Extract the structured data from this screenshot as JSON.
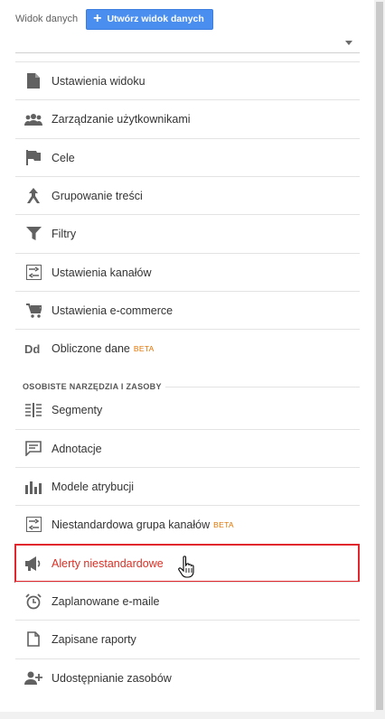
{
  "header": {
    "label": "Widok danych",
    "create_button": "Utwórz widok danych",
    "create_icon": "plus-icon"
  },
  "view_select": {
    "value": ""
  },
  "menu_main": [
    {
      "label": "Ustawienia widoku",
      "icon": "document-icon"
    },
    {
      "label": "Zarządzanie użytkownikami",
      "icon": "users-icon"
    },
    {
      "label": "Cele",
      "icon": "flag-icon"
    },
    {
      "label": "Grupowanie treści",
      "icon": "content-grouping-icon"
    },
    {
      "label": "Filtry",
      "icon": "filter-icon"
    },
    {
      "label": "Ustawienia kanałów",
      "icon": "channel-settings-icon"
    },
    {
      "label": "Ustawienia e-commerce",
      "icon": "cart-icon"
    },
    {
      "label": "Obliczone dane",
      "icon": "dd-icon",
      "badge": "BETA"
    }
  ],
  "section_title": "OSOBISTE NARZĘDZIA I ZASOBY",
  "menu_personal": [
    {
      "label": "Segmenty",
      "icon": "segments-icon"
    },
    {
      "label": "Adnotacje",
      "icon": "annotation-icon"
    },
    {
      "label": "Modele atrybucji",
      "icon": "bar-chart-icon"
    },
    {
      "label": "Niestandardowa grupa kanałów",
      "icon": "custom-channel-icon",
      "badge": "BETA"
    },
    {
      "label": "Alerty niestandardowe",
      "icon": "megaphone-icon",
      "active": true
    },
    {
      "label": "Zaplanowane e-maile",
      "icon": "alarm-clock-icon"
    },
    {
      "label": "Zapisane raporty",
      "icon": "saved-report-icon"
    },
    {
      "label": "Udostępnianie zasobów",
      "icon": "share-person-icon"
    }
  ],
  "colors": {
    "accent": "#4a8ef0",
    "active": "#d93025",
    "highlight_border": "#e2262e",
    "beta": "#e37400",
    "icon": "#616161"
  }
}
